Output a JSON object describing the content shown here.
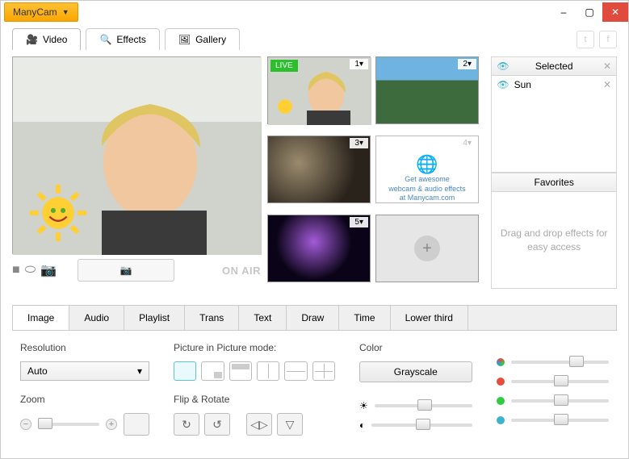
{
  "app": {
    "name": "ManyCam"
  },
  "window": {
    "minimize": "–",
    "maximize": "▢",
    "close": "✕"
  },
  "maintabs": {
    "video": "Video",
    "effects": "Effects",
    "gallery": "Gallery"
  },
  "preview": {
    "onair": "ON AIR"
  },
  "sources": {
    "live": "LIVE",
    "promo_line1": "Get awesome",
    "promo_line2": "webcam & audio effects",
    "promo_line3": "at Manycam.com",
    "n1": "1▾",
    "n2": "2▾",
    "n3": "3▾",
    "n4": "4▾",
    "n5": "5▾"
  },
  "rightpanel": {
    "selected": "Selected",
    "favorites": "Favorites",
    "effect1": "Sun",
    "fav_hint": "Drag and drop effects for easy access"
  },
  "subtabs": {
    "image": "Image",
    "audio": "Audio",
    "playlist": "Playlist",
    "trans": "Trans",
    "text": "Text",
    "draw": "Draw",
    "time": "Time",
    "lower": "Lower third"
  },
  "controls": {
    "resolution": "Resolution",
    "resolution_value": "Auto",
    "zoom": "Zoom",
    "pip": "Picture in Picture mode:",
    "flip": "Flip & Rotate",
    "color": "Color",
    "grayscale": "Grayscale"
  },
  "colors": {
    "rgb": "#",
    "r": "#e74c3c",
    "g": "#2ecc40",
    "b": "#3bb2cf"
  }
}
